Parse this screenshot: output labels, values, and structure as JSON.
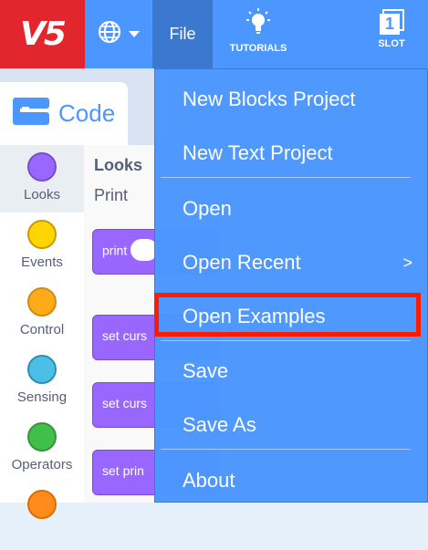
{
  "app": {
    "logo_text": "V5",
    "file_label": "File",
    "tutorials_label": "TUTORIALS",
    "slot_label": "SLOT",
    "slot_number": "1"
  },
  "code_tab": {
    "label": "Code"
  },
  "categories": [
    {
      "label": "Looks",
      "color": "#9966ff",
      "selected": true
    },
    {
      "label": "Events",
      "color": "#ffd500"
    },
    {
      "label": "Control",
      "color": "#ffab19"
    },
    {
      "label": "Sensing",
      "color": "#4cbfe6"
    },
    {
      "label": "Operators",
      "color": "#40bf4a"
    }
  ],
  "palette": {
    "heading": "Looks",
    "subheading": "Print",
    "blocks": [
      "print",
      "set curs",
      "set curs",
      "set prin"
    ]
  },
  "menu": {
    "items": [
      "New Blocks Project",
      "New Text Project",
      "Open",
      "Open Recent",
      "Open Examples",
      "Save",
      "Save As",
      "About"
    ],
    "submenu_arrow": ">"
  },
  "colors": {
    "topbar": "#4c97ff",
    "logo_bg": "#e1262d",
    "highlight": "#ff1a00"
  }
}
